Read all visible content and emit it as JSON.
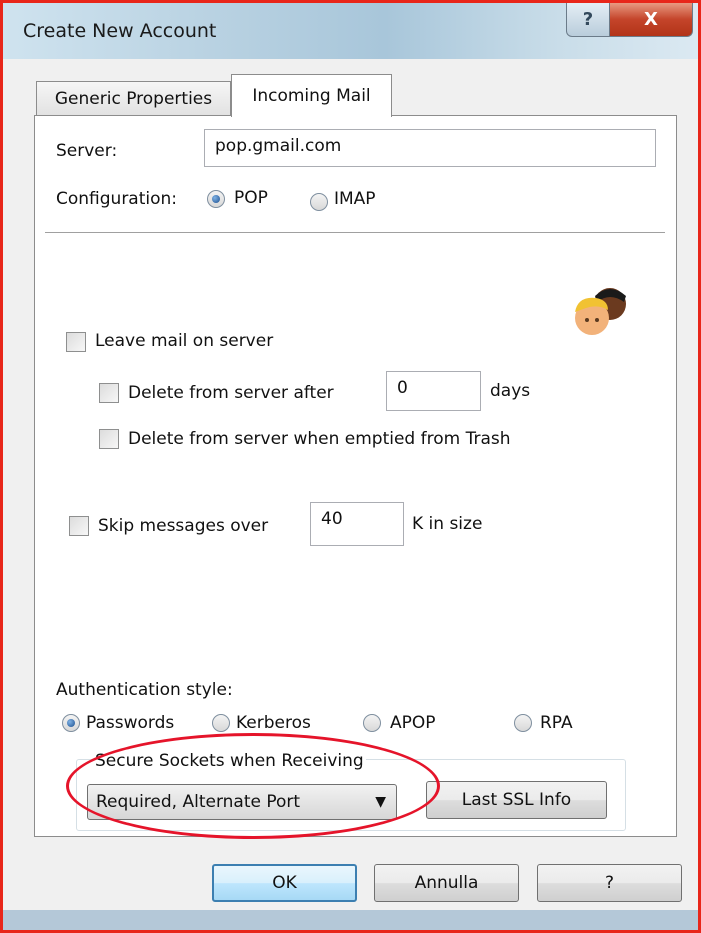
{
  "window": {
    "title": "Create New Account",
    "help_glyph": "?",
    "close_glyph": "X"
  },
  "tabs": [
    {
      "label": "Generic Properties",
      "active": false
    },
    {
      "label": "Incoming Mail",
      "active": true
    }
  ],
  "server": {
    "label": "Server:",
    "value": "pop.gmail.com"
  },
  "configuration": {
    "label": "Configuration:",
    "options": [
      {
        "label": "POP",
        "selected": true
      },
      {
        "label": "IMAP",
        "selected": false
      }
    ]
  },
  "leave_mail": {
    "label": "Leave mail on server",
    "checked": false
  },
  "delete_after": {
    "label": "Delete from server after",
    "checked": false,
    "value": "0",
    "unit": "days"
  },
  "delete_trash": {
    "label": "Delete from server when emptied from Trash",
    "checked": false
  },
  "skip": {
    "label": "Skip messages over",
    "checked": false,
    "value": "40",
    "unit": "K in size"
  },
  "auth": {
    "label": "Authentication style:",
    "options": [
      {
        "label": "Passwords",
        "selected": true
      },
      {
        "label": "Kerberos",
        "selected": false
      },
      {
        "label": "APOP",
        "selected": false
      },
      {
        "label": "RPA",
        "selected": false
      }
    ]
  },
  "ssl": {
    "group_label": "Secure Sockets when Receiving",
    "selected": "Required, Alternate Port",
    "arrow": "▼",
    "info_button": "Last SSL Info"
  },
  "footer": {
    "ok": "OK",
    "cancel": "Annulla",
    "help": "?"
  },
  "colors": {
    "annotation": "#e5142a",
    "frame": "#e8261a",
    "radio_selected": "#1c4f8f"
  },
  "icons": {
    "avatar": "users-icon"
  }
}
